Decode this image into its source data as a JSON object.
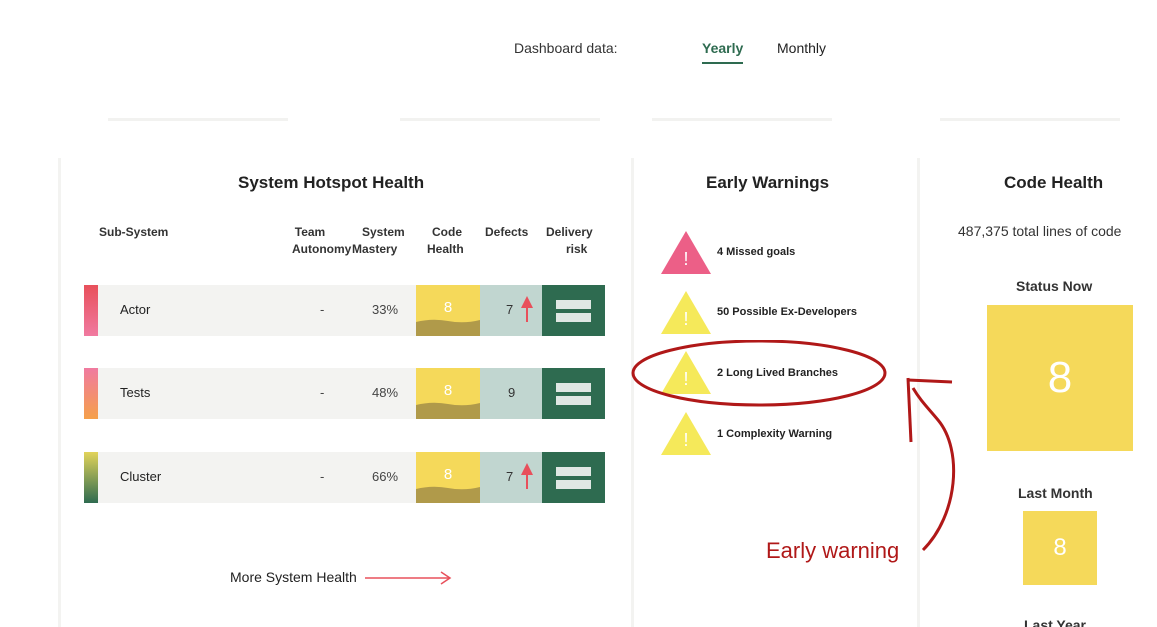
{
  "header": {
    "dashboard_label": "Dashboard data:",
    "tabs": [
      {
        "label": "Yearly",
        "active": true
      },
      {
        "label": "Monthly",
        "active": false
      }
    ]
  },
  "hotspot": {
    "title": "System Hotspot Health",
    "columns": {
      "subsystem": "Sub-System",
      "team_autonomy": [
        "Team",
        "Autonomy"
      ],
      "system_mastery": [
        "System",
        "Mastery"
      ],
      "code_health": [
        "Code",
        "Health"
      ],
      "defects": "Defects",
      "delivery_risk": [
        "Delivery",
        "risk"
      ]
    },
    "rows": [
      {
        "name": "Actor",
        "team_autonomy": "-",
        "system_mastery": "33%",
        "code_health": "8",
        "defects": "7",
        "defects_trend": "up"
      },
      {
        "name": "Tests",
        "team_autonomy": "-",
        "system_mastery": "48%",
        "code_health": "8",
        "defects": "9",
        "defects_trend": "none"
      },
      {
        "name": "Cluster",
        "team_autonomy": "-",
        "system_mastery": "66%",
        "code_health": "8",
        "defects": "7",
        "defects_trend": "up"
      }
    ],
    "more_link": "More System Health",
    "stripe_colors": [
      [
        "#e8505b",
        "#f07aa0"
      ],
      [
        "#f07aa0",
        "#f5a04a"
      ],
      [
        "#e2d35a",
        "#2e6b50"
      ]
    ]
  },
  "early_warnings": {
    "title": "Early Warnings",
    "items": [
      {
        "text": "4 Missed goals",
        "severity": "high",
        "color": "#ec5f87"
      },
      {
        "text": "50 Possible Ex-Developers",
        "severity": "medium",
        "color": "#f5e95a"
      },
      {
        "text": "2 Long Lived Branches",
        "severity": "medium",
        "color": "#f5e95a"
      },
      {
        "text": "1 Complexity Warning",
        "severity": "medium",
        "color": "#f5e95a"
      }
    ]
  },
  "code_health": {
    "title": "Code Health",
    "total_lines": "487,375 total lines of code",
    "status_now_label": "Status Now",
    "status_now_value": "8",
    "last_month_label": "Last Month",
    "last_month_value": "8",
    "last_year_label": "Last Year"
  },
  "annotation": {
    "text": "Early warning",
    "color": "#b01818"
  },
  "colors": {
    "accent": "#2e6b50",
    "health_yellow": "#f5d95a",
    "defects_bg": "#c1d6d0",
    "risk_bg": "#2e6b50"
  }
}
